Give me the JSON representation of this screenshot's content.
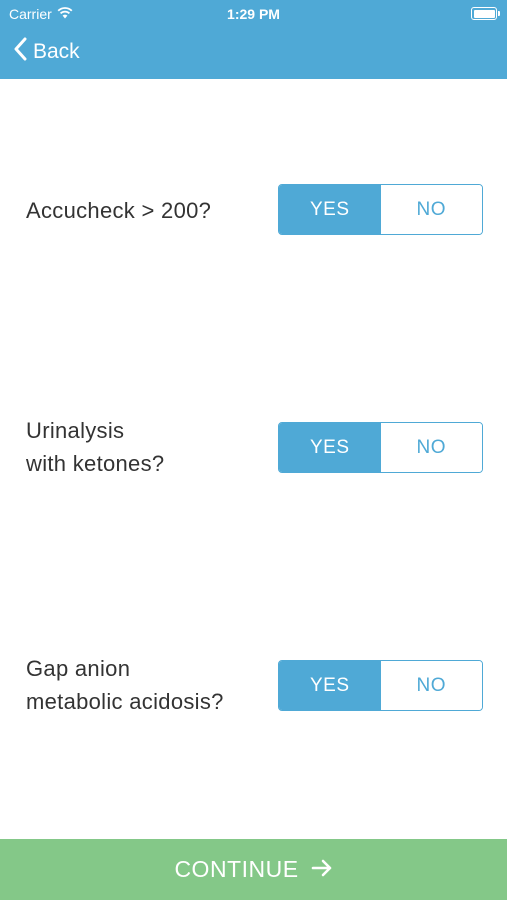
{
  "status_bar": {
    "carrier": "Carrier",
    "time": "1:29 PM"
  },
  "nav": {
    "back_label": "Back"
  },
  "questions": [
    {
      "label_line1": "Accucheck > 200?",
      "label_line2": "",
      "yes": "YES",
      "no": "NO",
      "selected": "YES"
    },
    {
      "label_line1": "Urinalysis",
      "label_line2": "with ketones?",
      "yes": "YES",
      "no": "NO",
      "selected": "YES"
    },
    {
      "label_line1": "Gap anion",
      "label_line2": "metabolic acidosis?",
      "yes": "YES",
      "no": "NO",
      "selected": "YES"
    }
  ],
  "footer": {
    "continue_label": "CONTINUE"
  },
  "colors": {
    "primary": "#4fa9d6",
    "continue": "#84c888",
    "text": "#333333"
  }
}
